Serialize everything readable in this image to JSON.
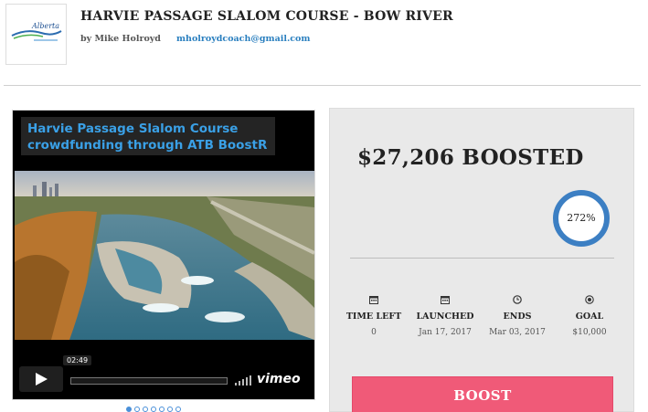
{
  "project": {
    "title": "HARVIE PASSAGE SLALOM COURSE - BOW RIVER",
    "author": "by Mike Holroyd",
    "email": "mholroydcoach@gmail.com"
  },
  "logo": {
    "icon": "alberta-slalom-canoe-kayak-logo",
    "text": "Alberta"
  },
  "video": {
    "title_line1": "Harvie Passage Slalom Course",
    "title_line2": "crowdfunding through ATB BoostR",
    "time": "02:49",
    "brand": "vimeo"
  },
  "carousel": {
    "count": 7,
    "active_index": 0
  },
  "stats": {
    "boosted": "$27,206 BOOSTED",
    "percent": "272%",
    "time_left": {
      "icon": "calendar-icon",
      "label": "TIME LEFT",
      "value": "0"
    },
    "launched": {
      "icon": "calendar-icon",
      "label": "LAUNCHED",
      "value": "Jan 17, 2017"
    },
    "ends": {
      "icon": "clock-icon",
      "label": "ENDS",
      "value": "Mar 03, 2017"
    },
    "goal": {
      "icon": "target-icon",
      "label": "GOAL",
      "value": "$10,000"
    }
  },
  "boost_button": "BOOST",
  "colors": {
    "accent_blue": "#3c7fc3",
    "boost_pink": "#f05a78",
    "link_blue": "#2a7fbf",
    "video_title_blue": "#3aa0e6"
  }
}
